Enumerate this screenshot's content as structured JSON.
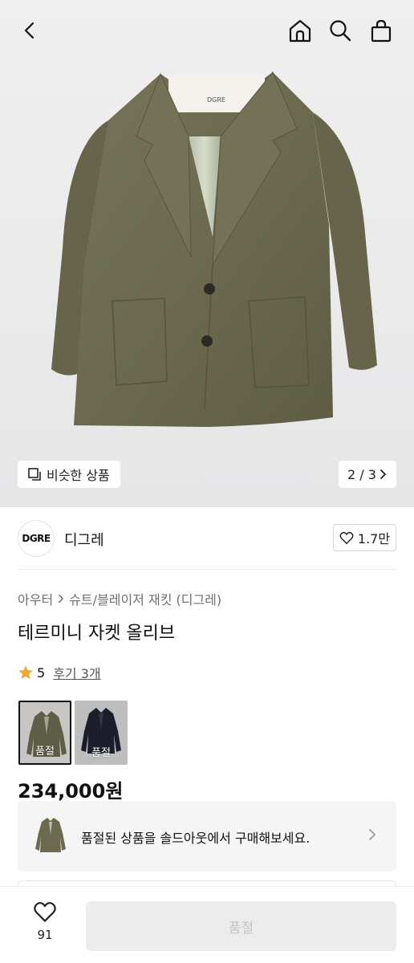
{
  "hero": {
    "similar_label": "비슷한 상품",
    "pager": "2 / 3",
    "label_text": "DGRE"
  },
  "brand": {
    "logo_text": "DGRE",
    "name": "디그레",
    "likes": "1.7만"
  },
  "product": {
    "breadcrumb": [
      "아우터",
      "슈트/블레이저 재킷 (디그레)"
    ],
    "title": "테르미니 자켓 올리브",
    "rating": "5",
    "reviews": "후기 3개",
    "price": "234,000원"
  },
  "swatches": [
    {
      "sold_label": "품절",
      "color": "#6b6a4f"
    },
    {
      "sold_label": "품절",
      "color": "#1f2330"
    }
  ],
  "soldout_banner": {
    "text": "품절된 상품을 솔드아웃에서 구매해보세요."
  },
  "bottom": {
    "wish_count": "91",
    "buy_label": "품절"
  },
  "colors": {
    "star": "#f3a53a",
    "jacket_olive": "#6b6a4f",
    "button_disabled_bg": "#ececec",
    "button_disabled_text": "#c3c3c3"
  },
  "icons": [
    "back-arrow-icon",
    "home-icon",
    "search-icon",
    "shopping-bag-icon",
    "copy-icon",
    "chevron-right-icon",
    "heart-icon",
    "star-icon"
  ]
}
